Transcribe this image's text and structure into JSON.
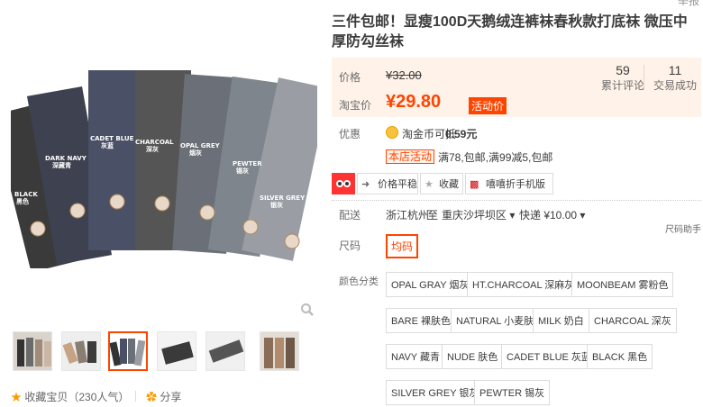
{
  "header": {
    "top_right": "举报"
  },
  "product": {
    "title": "三件包邮！显瘦100D天鹅绒连裤袜春秋款打底袜 微压中厚防勾丝袜",
    "image_labels": [
      "BLACK 黑色",
      "DARK NAVY 深藏青",
      "CADET BLUE 灰蓝",
      "CHARCOAL 深灰",
      "OPAL GREY 烟灰",
      "PEWTER 锡灰",
      "SILVER GREY 银灰"
    ]
  },
  "price": {
    "label": "价格",
    "original": "¥32.00",
    "taobao_label": "淘宝价",
    "current": "¥29.80",
    "promo": "活动价",
    "stats": [
      {
        "value": "59",
        "label": "累计评论"
      },
      {
        "value": "11",
        "label": "交易成功"
      }
    ]
  },
  "offers": {
    "label": "优惠",
    "coin_text": "淘金币可抵",
    "coin_value": "0.59元",
    "shop_tag": "本店活动",
    "shop_text": "满78,包邮,满99减5,包邮"
  },
  "tools": {
    "price_track": "价格平稳",
    "favorite": "收藏",
    "mobile": "嘻嘻折手机版"
  },
  "delivery": {
    "label": "配送",
    "from": "浙江杭州",
    "to_word": "至",
    "to": "重庆沙坪坝区",
    "express": "快递 ¥10.00",
    "helper": "尺码助手"
  },
  "size": {
    "label": "尺码",
    "value": "均码"
  },
  "colors": {
    "label": "颜色分类",
    "options": [
      "OPAL GRAY 烟灰",
      "HT.CHARCOAL 深麻灰",
      "MOONBEAM 雾粉色",
      "BARE 裸肤色",
      "NATURAL 小麦肤",
      "MILK 奶白",
      "CHARCOAL 深灰",
      "NAVY 藏青",
      "NUDE 肤色",
      "CADET BLUE 灰蓝",
      "BLACK 黑色",
      "SILVER GREY 银灰",
      "PEWTER 锡灰"
    ]
  },
  "footer": {
    "favorite": "收藏宝贝（230人气）",
    "share": "分享"
  }
}
